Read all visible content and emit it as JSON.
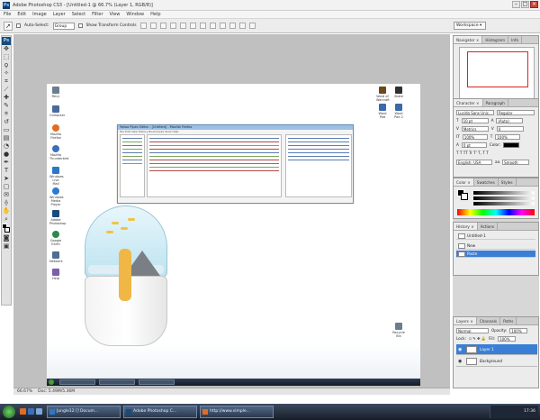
{
  "window": {
    "title": "Adobe Photoshop CS3 - [Untitled-1 @ 66.7% (Layer 1, RGB/8)]",
    "app_icon": "Ps",
    "controls": [
      "–",
      "□",
      "×"
    ]
  },
  "menu": [
    "File",
    "Edit",
    "Image",
    "Layer",
    "Select",
    "Filter",
    "View",
    "Window",
    "Help"
  ],
  "options": {
    "auto_select_label": "Auto-Select:",
    "auto_select_value": "Group",
    "transform_label": "Show Transform Controls",
    "workspace_label": "Workspace ▾"
  },
  "desktop_icons": [
    {
      "label": "Recy",
      "color": "#6b7d8f"
    },
    {
      "label": "Computer",
      "color": "#4a6a9a"
    },
    {
      "label": "Mozilla Firefox",
      "color": "#e26b25"
    },
    {
      "label": "Mozilla Thunderbird",
      "color": "#3a6fc0"
    },
    {
      "label": "Windows Live Mail",
      "color": "#2c78c8"
    },
    {
      "label": "Windows Media Player",
      "color": "#2f7ad1"
    },
    {
      "label": "Adobe Photoshop",
      "color": "#1a4a7a"
    },
    {
      "label": "Google Earth",
      "color": "#2a8a4a"
    },
    {
      "label": "Network",
      "color": "#4f6d8f"
    },
    {
      "label": "Help",
      "color": "#7b5fa8"
    }
  ],
  "desktop_icons_right": [
    {
      "label": "Word of Warcraft",
      "color": "#6a4a1a"
    },
    {
      "label": "Skate",
      "color": "#303030"
    },
    {
      "label": "Word Pad",
      "color": "#3a6aa8"
    },
    {
      "label": "Word Pad 2",
      "color": "#3a6aa8"
    },
    {
      "label": "Recycle Bin",
      "color": "#6b7d8f"
    }
  ],
  "inner_window": {
    "title": "Yahoo Pipes Editor - [Untitled] - Mozilla Firefox",
    "menu": "File  Edit  View  History  Bookmarks  Tools  Help"
  },
  "status": {
    "zoom": "66.67%",
    "doc_size": "Doc: 5.49M/5.36M"
  },
  "panels": {
    "navigator_tabs": [
      "Navigator ×",
      "Histogram",
      "Info"
    ],
    "navigator_zoom": "66.67%",
    "character_tabs": [
      "Character ×",
      "Paragraph"
    ],
    "font_family": "Lucida Sans Unic...",
    "font_style": "Regular",
    "font_size": "10 pt",
    "leading": "(Auto)",
    "kerning": "Metrics",
    "tracking": "0",
    "vscale": "100%",
    "hscale": "100%",
    "baseline": "0 pt",
    "color_label": "Color:",
    "language": "English: USA",
    "anti_alias": "Smooth",
    "color_tabs": [
      "Color ×",
      "Swatches",
      "Styles"
    ],
    "history_tabs": [
      "History ×",
      "Actions"
    ],
    "history_doc": "Untitled-1",
    "history_items": [
      "New",
      "Paste"
    ],
    "layers_tabs": [
      "Layers ×",
      "Channels",
      "Paths"
    ],
    "blend_mode": "Normal",
    "opacity_label": "Opacity:",
    "opacity_value": "100%",
    "lock_label": "Lock:",
    "fill_label": "Fill:",
    "fill_value": "100%",
    "layers": [
      "Layer 1",
      "Background"
    ]
  },
  "taskbar": {
    "buttons": [
      "Jungle12 [] Docum...",
      "Adobe Photoshop C...",
      "http://www.simple..."
    ],
    "clock": "17:36"
  }
}
